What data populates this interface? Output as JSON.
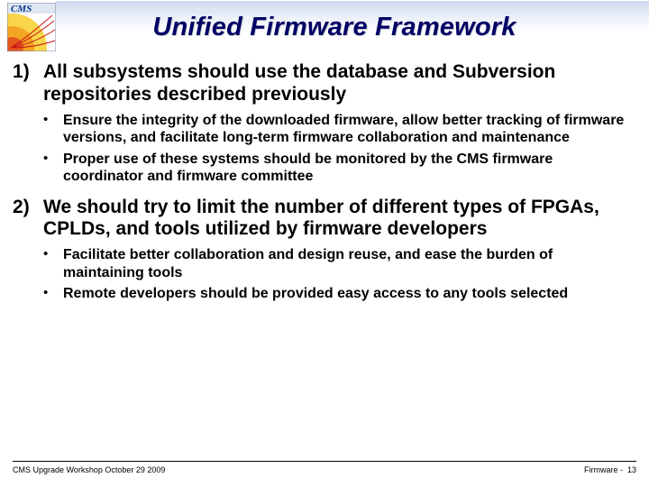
{
  "logo": {
    "label": "CMS"
  },
  "title": "Unified Firmware Framework",
  "points": [
    {
      "text": "All subsystems should use the database and Subversion repositories described previously",
      "sub": [
        "Ensure the integrity of the downloaded firmware, allow better tracking of firmware versions, and facilitate long-term firmware collaboration and maintenance",
        "Proper use of these systems should be monitored by the CMS firmware coordinator and firmware committee"
      ]
    },
    {
      "text": "We should try to limit the number of different types of FPGAs, CPLDs, and tools utilized by firmware developers",
      "sub": [
        "Facilitate better collaboration and design reuse, and ease the burden of maintaining tools",
        "Remote developers should be provided easy access to any tools selected"
      ]
    }
  ],
  "footer": {
    "left": "CMS Upgrade Workshop October 29 2009",
    "right_label": "Firmware - ",
    "right_page": "13"
  }
}
